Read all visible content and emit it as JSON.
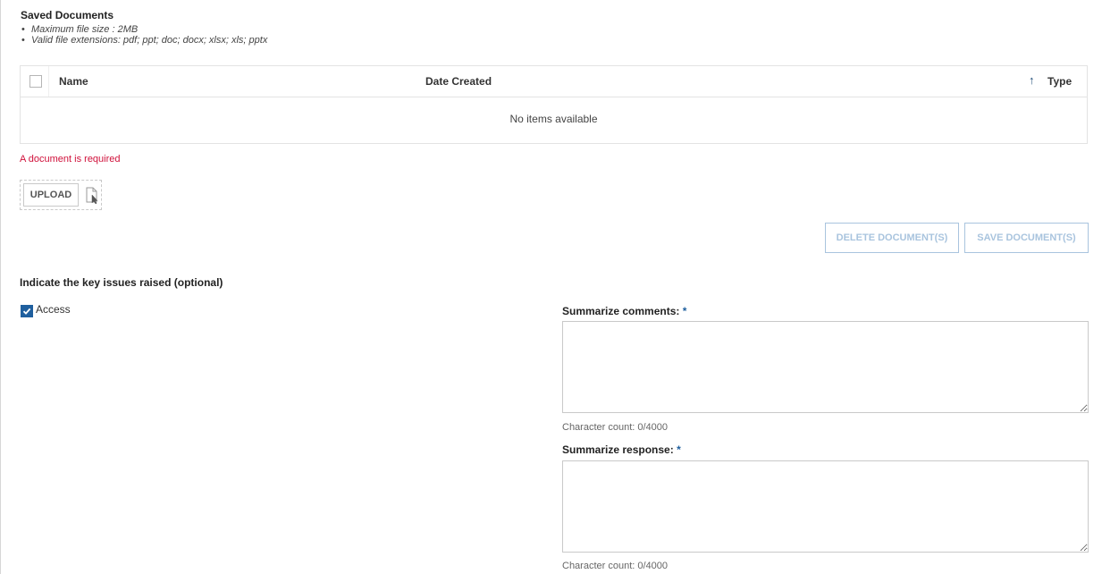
{
  "saved_documents": {
    "title": "Saved Documents",
    "notes": [
      "Maximum file size : 2MB",
      "Valid file extensions: pdf; ppt; doc; docx; xlsx; xls; pptx"
    ],
    "columns": {
      "name": "Name",
      "date_created": "Date Created",
      "type": "Type"
    },
    "sort_icon": "arrow-up-icon",
    "empty_message": "No items available",
    "error_message": "A document is required",
    "upload_label": "UPLOAD",
    "upload_icon": "file-select-icon",
    "delete_label": "DELETE DOCUMENT(S)",
    "save_label": "SAVE DOCUMENT(S)"
  },
  "issues": {
    "title": "Indicate the key issues raised (optional)",
    "items": [
      {
        "label": "Access",
        "checked": true
      }
    ]
  },
  "comments": {
    "label": "Summarize comments:",
    "required_mark": "*",
    "value": "",
    "counter": "Character count: 0/4000"
  },
  "response": {
    "label": "Summarize response:",
    "required_mark": "*",
    "value": "",
    "counter": "Character count: 0/4000"
  },
  "colors": {
    "error": "#d0103a",
    "accent": "#1f5f9e",
    "disabled_button": "#a9c4de"
  }
}
